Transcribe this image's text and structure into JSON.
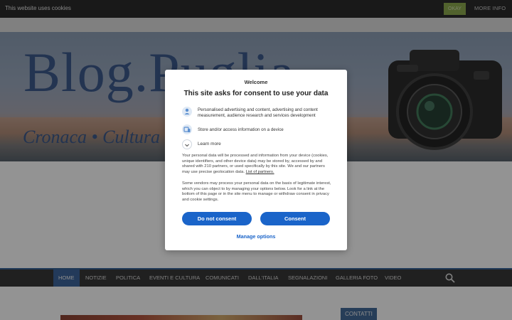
{
  "cookie_bar": {
    "text": "This website uses cookies",
    "okay_label": "OKAY",
    "more_info_label": "MORE INFO"
  },
  "banner": {
    "title": "Blog.Puglia",
    "subtitle": "Cronaca • Cultura • S"
  },
  "nav": {
    "items": [
      {
        "label": "HOME",
        "active": true
      },
      {
        "label": "NOTIZIE",
        "active": false
      },
      {
        "label": "POLITICA",
        "active": false
      },
      {
        "label": "EVENTI E CULTURA",
        "active": false
      },
      {
        "label": "COMUNICATI",
        "active": false
      },
      {
        "label": "DALL'ITALIA",
        "active": false
      },
      {
        "label": "SEGNALAZIONI",
        "active": false
      },
      {
        "label": "GALLERIA FOTO",
        "active": false
      },
      {
        "label": "VIDEO",
        "active": false
      }
    ],
    "search_icon": "search-icon"
  },
  "sidebar": {
    "contatti_label": "CONTATTI"
  },
  "consent": {
    "welcome": "Welcome",
    "title": "This site asks for consent to use your data",
    "purposes": [
      {
        "icon": "person-icon",
        "text": "Personalised advertising and content, advertising and content measurement, audience research and services development"
      },
      {
        "icon": "device-icon",
        "text": "Store and/or access information on a device"
      }
    ],
    "learn_more": "Learn more",
    "paragraph1": "Your personal data will be processed and information from your device (cookies, unique identifiers, and other device data) may be stored by, accessed by and shared with 210 partners, or used specifically by this site. We and our partners may use precise geolocation data.",
    "partners_link": "List of partners.",
    "paragraph2": "Some vendors may process your personal data on the basis of legitimate interest, which you can object to by managing your options below. Look for a link at the bottom of this page or in the site menu to manage or withdraw consent in privacy and cookie settings.",
    "do_not_consent_label": "Do not consent",
    "consent_label": "Consent",
    "manage_options_label": "Manage options"
  },
  "colors": {
    "accent": "#1a64c9",
    "nav_active": "#27508a",
    "okay_button": "#7a9a3a"
  }
}
